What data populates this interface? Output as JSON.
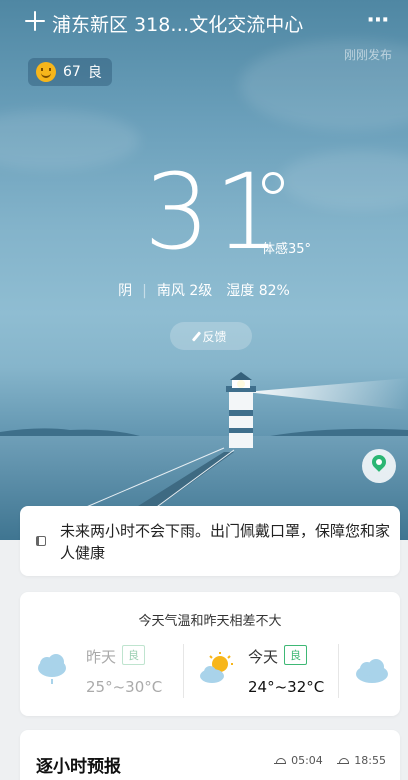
{
  "header": {
    "location": "浦东新区 318…文化交流中心",
    "more_icon": "⋯",
    "published": "刚刚发布",
    "aqi": {
      "value": "67",
      "label": "良"
    }
  },
  "current": {
    "temperature": "31",
    "feels_like": "体感35°",
    "weather": "阴",
    "wind": "南风 2级",
    "humidity": "湿度 82%",
    "feedback": "反馈"
  },
  "notice": {
    "text": "未来两小时不会下雨。出门佩戴口罩，保障您和家人健康"
  },
  "comparison": {
    "headline": "今天气温和昨天相差不大",
    "yesterday": {
      "name": "昨天",
      "aqi": "良",
      "range": "25°~30°C",
      "icon": "rain-cloud-icon"
    },
    "today": {
      "name": "今天",
      "aqi": "良",
      "range": "24°~32°C",
      "icon": "partly-sunny-icon"
    },
    "tomorrow": {
      "icon": "cloud-icon"
    }
  },
  "hourly": {
    "title": "逐小时预报",
    "sunrise": "05:04",
    "sunset": "18:55"
  },
  "colors": {
    "aqi_good": "#3eb875",
    "sun": "#f7b61b",
    "map_pin": "#2bb673"
  }
}
